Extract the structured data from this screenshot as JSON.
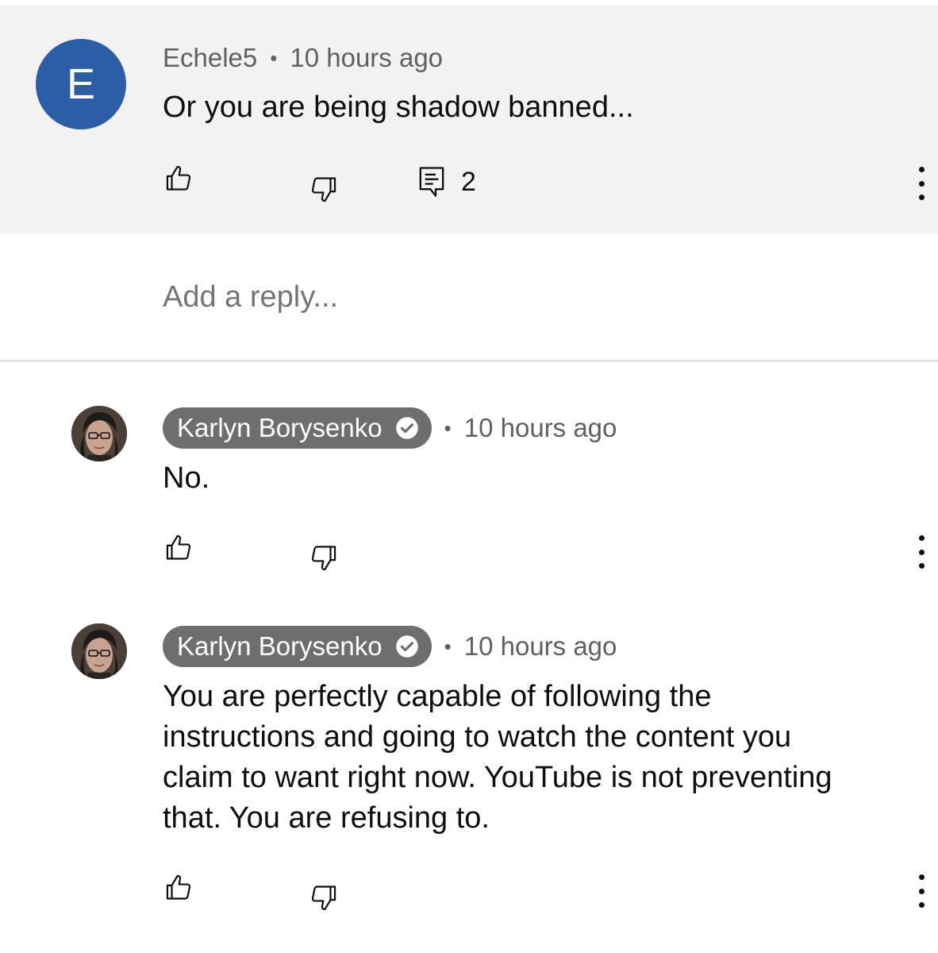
{
  "parent_comment": {
    "avatar_letter": "E",
    "avatar_color": "#2b5ea6",
    "author": "Echele5",
    "separator": "•",
    "time": "10 hours ago",
    "text": "Or you are being shadow banned...",
    "reply_count": "2",
    "icons": [
      "thumbs-up-icon",
      "thumbs-down-icon",
      "comment-icon",
      "more-vertical-icon"
    ]
  },
  "reply_input": {
    "placeholder": "Add a reply..."
  },
  "replies": [
    {
      "author": "Karlyn Borysenko",
      "verified": true,
      "separator": "•",
      "time": "10 hours ago",
      "text": "No."
    },
    {
      "author": "Karlyn Borysenko",
      "verified": true,
      "separator": "•",
      "time": "10 hours ago",
      "text_lines": [
        "You are perfectly capable of following the",
        "instructions and going to watch the content you",
        "claim to want right now. YouTube is not preventing",
        "that. You are refusing to."
      ]
    }
  ],
  "colors": {
    "parent_background": "#f2f2f2",
    "author_chip": "#6e6e6e",
    "meta_text": "#606060"
  }
}
